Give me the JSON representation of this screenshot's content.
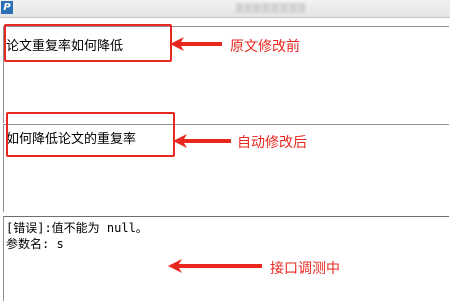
{
  "titlebar": {
    "app_icon_letter": "P",
    "app_icon": "app-logo-icon",
    "title_blurred": true
  },
  "original_pane": {
    "text": "论文重复率如何降低"
  },
  "modified_pane": {
    "text": "如何降低论文的重复率"
  },
  "console_pane": {
    "lines": [
      "[错误]:值不能为 null。",
      "参数名: s"
    ]
  },
  "annotations": {
    "before": "原文修改前",
    "after": "自动修改后",
    "debug": "接口调测中"
  },
  "colors": {
    "annotation": "#e8281f",
    "app_icon": "#2d6fb6"
  }
}
